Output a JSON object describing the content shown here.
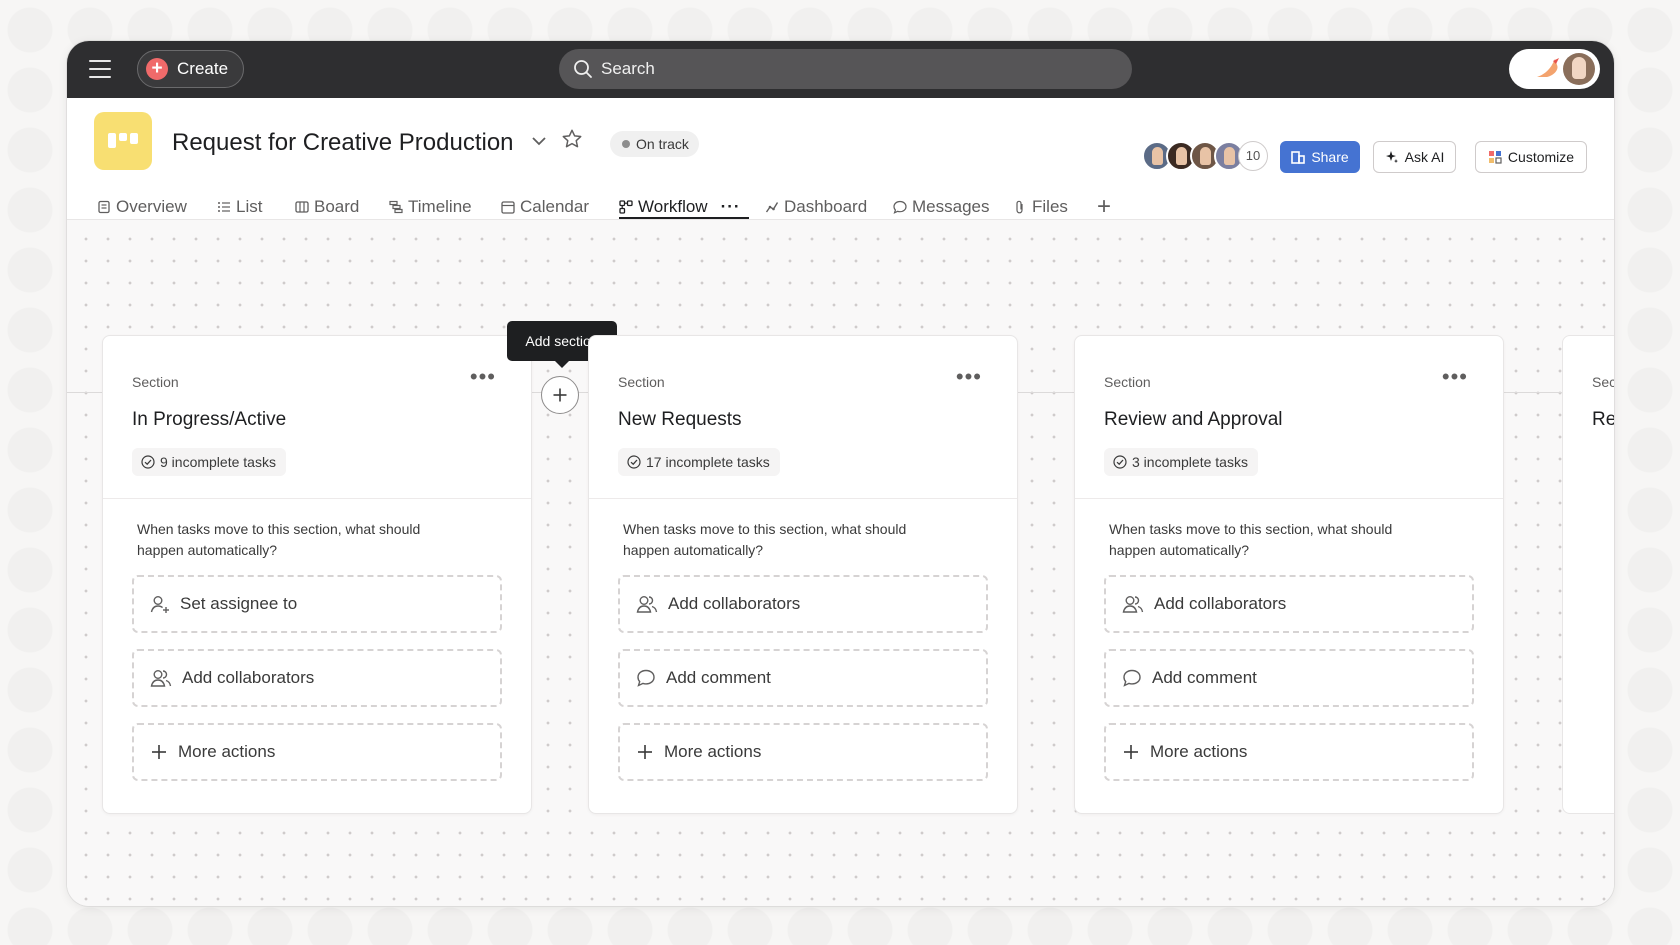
{
  "topbar": {
    "create_label": "Create",
    "search_placeholder": "Search"
  },
  "project": {
    "title": "Request for Creative Production",
    "status": "On track",
    "member_count": "10",
    "share_label": "Share",
    "ask_ai_label": "Ask AI",
    "customize_label": "Customize"
  },
  "tabs": [
    {
      "label": "Overview",
      "icon": "overview-icon"
    },
    {
      "label": "List",
      "icon": "list-icon"
    },
    {
      "label": "Board",
      "icon": "board-icon"
    },
    {
      "label": "Timeline",
      "icon": "timeline-icon"
    },
    {
      "label": "Calendar",
      "icon": "calendar-icon"
    },
    {
      "label": "Workflow",
      "icon": "workflow-icon",
      "active": true
    },
    {
      "label": "Dashboard",
      "icon": "dashboard-icon"
    },
    {
      "label": "Messages",
      "icon": "messages-icon"
    },
    {
      "label": "Files",
      "icon": "files-icon"
    }
  ],
  "tooltip": "Add section",
  "sections": [
    {
      "eyebrow": "Section",
      "name": "In Progress/Active",
      "count": "9 incomplete tasks",
      "question": "When tasks move to this section, what should happen automatically?",
      "actions": [
        "Set assignee to",
        "Add collaborators",
        "More actions"
      ]
    },
    {
      "eyebrow": "Section",
      "name": "New Requests",
      "count": "17 incomplete tasks",
      "question": "When tasks move to this section, what should happen automatically?",
      "actions": [
        "Add collaborators",
        "Add comment",
        "More actions"
      ]
    },
    {
      "eyebrow": "Section",
      "name": "Review and Approval",
      "count": "3 incomplete tasks",
      "question": "When tasks move to this section, what should happen automatically?",
      "actions": [
        "Add collaborators",
        "Add comment",
        "More actions"
      ]
    }
  ],
  "colors": {
    "topbar": "#2e2e30",
    "accent_create": "#f06a6a",
    "share_blue": "#4573d2",
    "project_icon": "#f8df72"
  }
}
